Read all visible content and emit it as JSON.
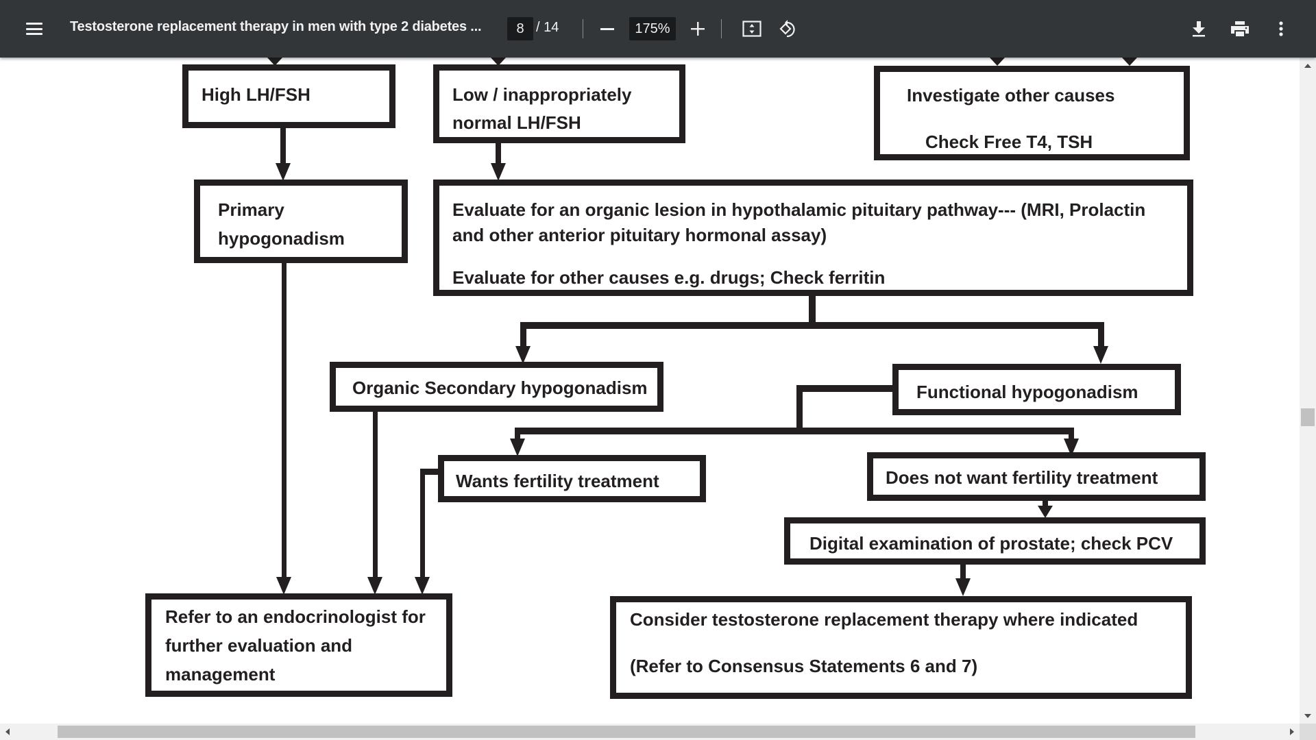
{
  "toolbar": {
    "menu_icon": "hamburger-menu-icon",
    "title": "Testosterone replacement therapy in men with type 2 diabetes ...",
    "current_page": "8",
    "total_pages": "/ 14",
    "zoom_level": "175%",
    "zoom_out_icon": "minus-icon",
    "zoom_in_icon": "plus-icon",
    "fit_icon": "fit-to-page-icon",
    "rotate_icon": "rotate-counterclockwise-icon",
    "download_icon": "download-icon",
    "print_icon": "print-icon",
    "more_icon": "more-vertical-icon"
  },
  "flowchart": {
    "high_lh_fsh": "High LH/FSH",
    "low_lh_fsh": [
      "Low / inappropriately",
      "normal LH/FSH"
    ],
    "investigate": [
      "Investigate other causes",
      "Check Free T4, TSH"
    ],
    "primary": [
      "Primary",
      "hypogonadism"
    ],
    "evaluate": [
      "Evaluate for an organic lesion in hypothalamic pituitary pathway--- (MRI, Prolactin",
      "and other anterior pituitary hormonal assay)",
      "Evaluate for other causes e.g. drugs; Check ferritin"
    ],
    "organic_secondary": "Organic Secondary hypogonadism",
    "functional": "Functional hypogonadism",
    "wants_fertility": "Wants fertility treatment",
    "no_fertility": "Does not want fertility treatment",
    "digital_exam": "Digital examination of prostate; check PCV",
    "refer": [
      "Refer to an endocrinologist for",
      "further evaluation and",
      "management"
    ],
    "consider": [
      "Consider testosterone replacement therapy where indicated",
      "(Refer to Consensus Statements 6 and 7)"
    ]
  },
  "colors": {
    "toolbar_bg": "#323639",
    "diagram_ink": "#231f20",
    "scrollbar_thumb": "#c1c1c1"
  }
}
